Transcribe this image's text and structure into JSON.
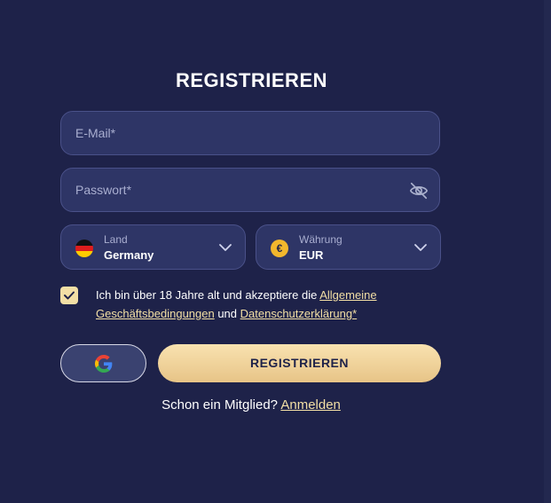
{
  "form": {
    "title": "REGISTRIEREN",
    "email": {
      "placeholder": "E-Mail*",
      "value": ""
    },
    "password": {
      "placeholder": "Passwort*",
      "value": ""
    },
    "country": {
      "label": "Land",
      "value": "Germany",
      "icon": "germany-flag-icon"
    },
    "currency": {
      "label": "Währung",
      "value": "EUR",
      "icon": "euro-coin-icon",
      "symbol": "€"
    },
    "terms": {
      "checked": true,
      "text_before": "Ich bin über 18 Jahre alt und akzeptiere die ",
      "terms_link": "Allgemeine Geschäftsbedingungen",
      "text_middle": " und ",
      "privacy_link": "Datenschutzerklärung*"
    },
    "google_button": {
      "icon": "google-icon"
    },
    "register_button": "REGISTRIEREN",
    "login_prompt": "Schon ein Mitglied?",
    "login_link": "Anmelden"
  },
  "colors": {
    "background": "#1e2249",
    "field": "#2e3566",
    "accent": "#f3dfa5",
    "text": "#ffffff"
  }
}
